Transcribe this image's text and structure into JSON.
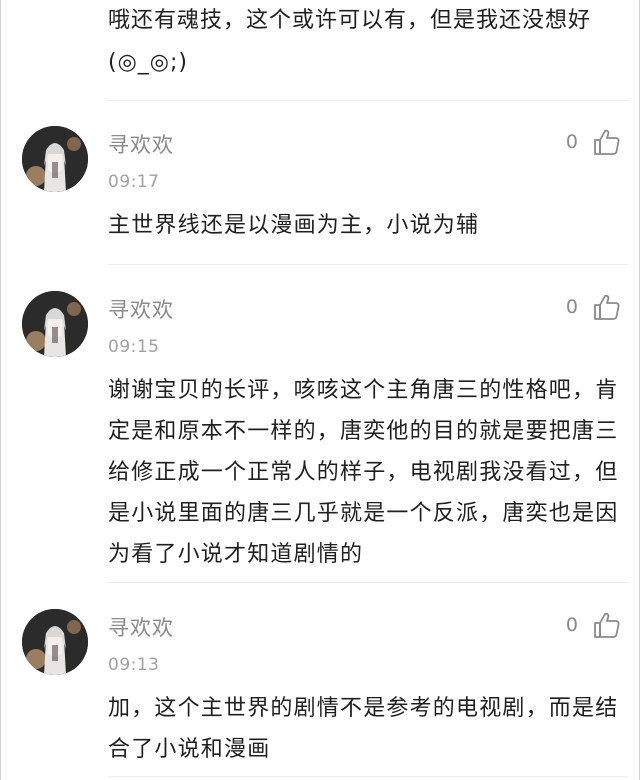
{
  "top_text": "哦还有魂技，这个或许可以有，但是我还没想好(◎_◎;)",
  "comments": [
    {
      "username": "寻欢欢",
      "time": "09:17",
      "likes": "0",
      "text": "主世界线还是以漫画为主，小说为辅"
    },
    {
      "username": "寻欢欢",
      "time": "09:15",
      "likes": "0",
      "text": "谢谢宝贝的长评，咳咳这个主角唐三的性格吧，肯定是和原本不一样的，唐奕他的目的就是要把唐三给修正成一个正常人的样子，电视剧我没看过，但是小说里面的唐三几乎就是一个反派，唐奕也是因为看了小说才知道剧情的"
    },
    {
      "username": "寻欢欢",
      "time": "09:13",
      "likes": "0",
      "text": "加，这个主世界的剧情不是参考的电视剧，而是结合了小说和漫画"
    }
  ],
  "icons": {
    "like": "thumbs-up-icon",
    "avatar": "avatar-illustration"
  },
  "colors": {
    "text": "#1f1f1f",
    "meta": "#8a8a8a",
    "divider": "#ececec"
  }
}
